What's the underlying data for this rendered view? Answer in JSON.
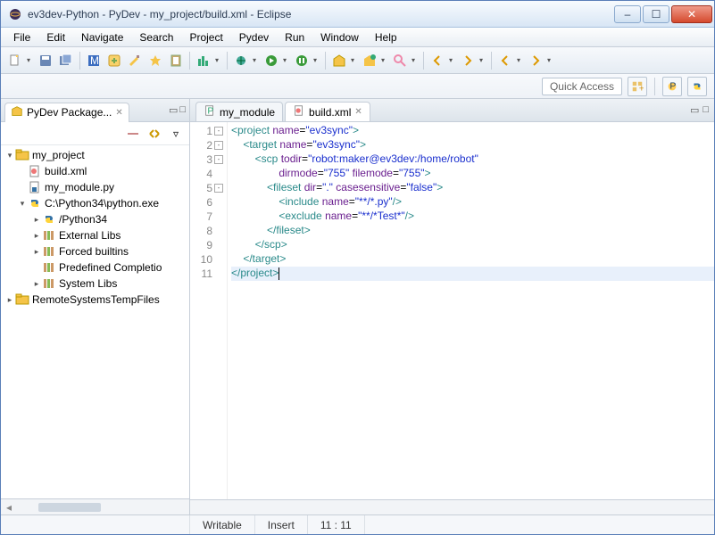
{
  "window": {
    "title": "ev3dev-Python - PyDev - my_project/build.xml - Eclipse"
  },
  "menu": [
    "File",
    "Edit",
    "Navigate",
    "Search",
    "Project",
    "Pydev",
    "Run",
    "Window",
    "Help"
  ],
  "quick_access": "Quick Access",
  "sidebar": {
    "view_title": "PyDev Package...",
    "tree": {
      "project": "my_project",
      "build": "build.xml",
      "module": "my_module.py",
      "interpreter": "C:\\Python34\\python.exe",
      "python34": "/Python34",
      "external_libs": "External Libs",
      "forced_builtins": "Forced builtins",
      "predefined": "Predefined Completio",
      "system_libs": "System Libs",
      "remote": "RemoteSystemsTempFiles"
    }
  },
  "editor": {
    "tabs": [
      {
        "label": "my_module",
        "active": false
      },
      {
        "label": "build.xml",
        "active": true
      }
    ],
    "lines": [
      {
        "n": 1,
        "fold": "-",
        "html": "<span class='t-tag'>&lt;project</span> <span class='t-attr'>name</span>=<span class='t-str'>\"ev3sync\"</span><span class='t-tag'>&gt;</span>"
      },
      {
        "n": 2,
        "fold": "-",
        "html": "    <span class='t-tag'>&lt;target</span> <span class='t-attr'>name</span>=<span class='t-str'>\"ev3sync\"</span><span class='t-tag'>&gt;</span>"
      },
      {
        "n": 3,
        "fold": "-",
        "html": "        <span class='t-tag'>&lt;scp</span> <span class='t-attr'>todir</span>=<span class='t-str'>\"robot:maker@ev3dev:/home/robot\"</span>"
      },
      {
        "n": 4,
        "fold": "",
        "html": "                <span class='t-attr'>dirmode</span>=<span class='t-str'>\"755\"</span> <span class='t-attr'>filemode</span>=<span class='t-str'>\"755\"</span><span class='t-tag'>&gt;</span>"
      },
      {
        "n": 5,
        "fold": "-",
        "html": "            <span class='t-tag'>&lt;fileset</span> <span class='t-attr'>dir</span>=<span class='t-str'>\".\"</span> <span class='t-attr'>casesensitive</span>=<span class='t-str'>\"false\"</span><span class='t-tag'>&gt;</span>"
      },
      {
        "n": 6,
        "fold": "",
        "html": "                <span class='t-tag'>&lt;include</span> <span class='t-attr'>name</span>=<span class='t-str'>\"**/*.py\"</span><span class='t-tag'>/&gt;</span>"
      },
      {
        "n": 7,
        "fold": "",
        "html": "                <span class='t-tag'>&lt;exclude</span> <span class='t-attr'>name</span>=<span class='t-str'>\"**/*Test*\"</span><span class='t-tag'>/&gt;</span>"
      },
      {
        "n": 8,
        "fold": "",
        "html": "            <span class='t-tag'>&lt;/fileset&gt;</span>"
      },
      {
        "n": 9,
        "fold": "",
        "html": "        <span class='t-tag'>&lt;/scp&gt;</span>"
      },
      {
        "n": 10,
        "fold": "",
        "html": "    <span class='t-tag'>&lt;/target&gt;</span>"
      },
      {
        "n": 11,
        "fold": "",
        "html": "<span class='t-tag'>&lt;/project&gt;</span><span class='cursor-bar'></span>",
        "hl": true
      }
    ]
  },
  "status": {
    "writable": "Writable",
    "insert": "Insert",
    "pos": "11 : 11"
  }
}
